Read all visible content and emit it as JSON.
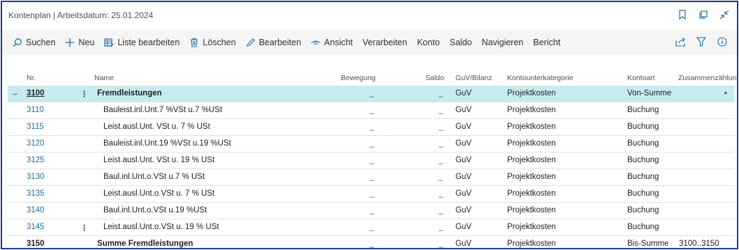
{
  "header": {
    "title": "Kontenplan | Arbeitsdatum: 25.01.2024",
    "icons": [
      "bookmark-icon",
      "open-new-window-icon",
      "collapse-icon"
    ]
  },
  "toolbar": {
    "items": [
      {
        "label": "Suchen",
        "icon": "search-icon"
      },
      {
        "label": "Neu",
        "icon": "plus-icon"
      },
      {
        "label": "Liste bearbeiten",
        "icon": "edit-list-icon"
      },
      {
        "label": "Löschen",
        "icon": "trash-icon"
      },
      {
        "label": "Bearbeiten",
        "icon": "pencil-icon"
      },
      {
        "label": "Ansicht",
        "icon": "eye-icon"
      },
      {
        "label": "Verarbeiten"
      },
      {
        "label": "Konto"
      },
      {
        "label": "Saldo"
      },
      {
        "label": "Navigieren"
      },
      {
        "label": "Bericht"
      }
    ],
    "right_icons": [
      "share-icon",
      "filter-icon",
      "info-icon"
    ]
  },
  "table": {
    "columns": {
      "nr": "Nr.",
      "name": "Name",
      "bewegung": "Bewegung",
      "saldo": "Saldo",
      "guv": "GuV/Bilanz",
      "kategorie": "Kontounterkategorie",
      "kontoart": "Kontoart",
      "zusammen": "Zusammenzählung"
    },
    "rows": [
      {
        "nr": "3100",
        "name": "Fremdleistungen",
        "bew": "_",
        "saldo": "_",
        "guv": "GuV",
        "kat": "Projektkosten",
        "art": "Von-Summe",
        "zus": ""
      },
      {
        "nr": "3110",
        "name": "Bauleist.inl.Unt.7 %VSt u.7 %USt",
        "bew": "_",
        "saldo": "_",
        "guv": "GuV",
        "kat": "Projektkosten",
        "art": "Buchung",
        "zus": ""
      },
      {
        "nr": "3115",
        "name": "Leist.ausl.Unt. VSt u. 7 % USt",
        "bew": "_",
        "saldo": "_",
        "guv": "GuV",
        "kat": "Projektkosten",
        "art": "Buchung",
        "zus": ""
      },
      {
        "nr": "3120",
        "name": "Bauleist.inl.Unt.19 %VSt u.19 %USt",
        "bew": "_",
        "saldo": "_",
        "guv": "GuV",
        "kat": "Projektkosten",
        "art": "Buchung",
        "zus": ""
      },
      {
        "nr": "3125",
        "name": "Leist.ausl.Unt. VSt u. 19 % USt",
        "bew": "_",
        "saldo": "_",
        "guv": "GuV",
        "kat": "Projektkosten",
        "art": "Buchung",
        "zus": ""
      },
      {
        "nr": "3130",
        "name": "Baul.inl.Unt.o.VSt u.7 % USt",
        "bew": "_",
        "saldo": "_",
        "guv": "GuV",
        "kat": "Projektkosten",
        "art": "Buchung",
        "zus": ""
      },
      {
        "nr": "3135",
        "name": "Leist.ausl.Unt.o.VSt u. 7 % USt",
        "bew": "_",
        "saldo": "_",
        "guv": "GuV",
        "kat": "Projektkosten",
        "art": "Buchung",
        "zus": ""
      },
      {
        "nr": "3140",
        "name": "Baul.inl.Unt.o.VSt u.19 %USt",
        "bew": "_",
        "saldo": "_",
        "guv": "GuV",
        "kat": "Projektkosten",
        "art": "Buchung",
        "zus": ""
      },
      {
        "nr": "3145",
        "name": "Leist.ausl.Unt.o.VSt u. 19 % USt",
        "bew": "_",
        "saldo": "_",
        "guv": "GuV",
        "kat": "Projektkosten",
        "art": "Buchung",
        "zus": ""
      },
      {
        "nr": "3150",
        "name": "Summe Fremdleistungen",
        "bew": "_",
        "saldo": "_",
        "guv": "GuV",
        "kat": "Projektkosten",
        "art": "Bis-Summe",
        "zus": "3100..3150"
      }
    ],
    "row_marker": "→",
    "row_menu": "⋮"
  },
  "colors": {
    "accent": "#1a6ea8",
    "selected_row": "#c7ecf0",
    "frame_border": "#1d3a8a",
    "toolbar_bg": "#f5f5f5"
  }
}
